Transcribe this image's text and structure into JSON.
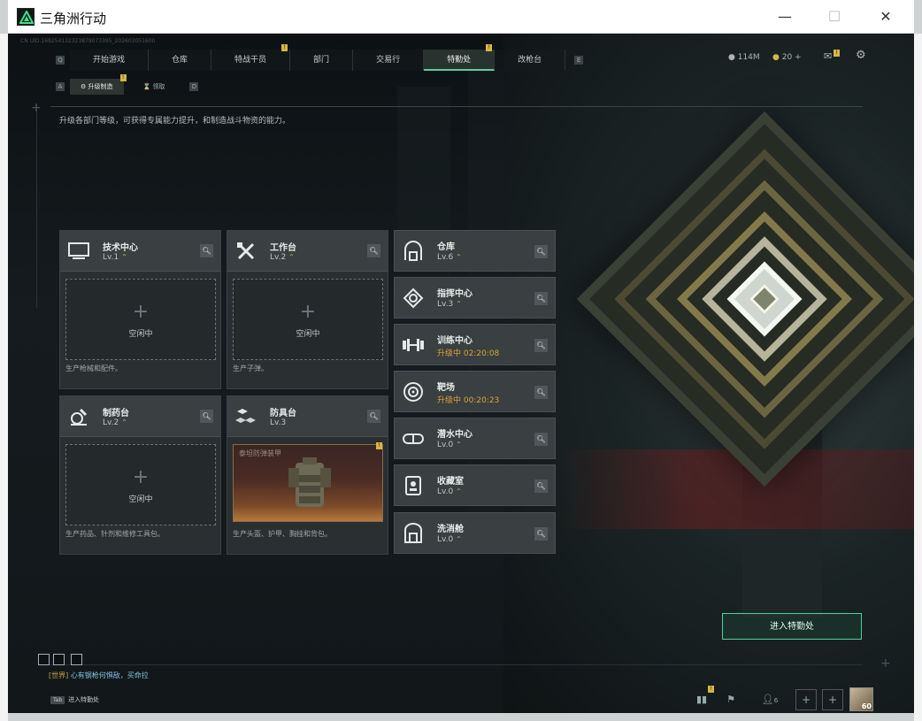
{
  "window": {
    "title": "三角洲行动",
    "minimize": "—",
    "maximize": "☐",
    "close": "✕"
  },
  "top_info": "CN UID:169254132323879073395_202603051600",
  "tabs": [
    {
      "label": "开始游戏",
      "badge": ""
    },
    {
      "label": "仓库",
      "badge": ""
    },
    {
      "label": "特战干员",
      "badge": "!"
    },
    {
      "label": "部门",
      "badge": ""
    },
    {
      "label": "交易行",
      "badge": ""
    },
    {
      "label": "特勤处",
      "badge": "!"
    },
    {
      "label": "改枪台",
      "badge": ""
    }
  ],
  "tab_prev_key": "Q",
  "tab_next_key": "E",
  "currency": {
    "coins": "114M",
    "tickets": "20",
    "add": "+"
  },
  "subtabs": [
    {
      "label": "升级制造",
      "badge": "!"
    },
    {
      "label": "领取",
      "badge": ""
    }
  ],
  "subtab_prev_key": "A",
  "subtab_next_key": "D",
  "description": "升级各部门等级，可获得专属能力提升，和制造战斗物资的能力。",
  "production": [
    {
      "name": "技术中心",
      "level": "Lv.1",
      "slot": "空闲中",
      "footer": "生产枪械和配件。"
    },
    {
      "name": "工作台",
      "level": "Lv.2",
      "slot": "空闲中",
      "footer": "生产子弹。"
    },
    {
      "name": "制药台",
      "level": "Lv.2",
      "slot": "空闲中",
      "footer": "生产药品、针剂和维修工具包。"
    },
    {
      "name": "防具台",
      "level": "Lv.3",
      "slot_item": "泰坦防弹装甲",
      "footer": "生产头盔、护甲、胸挂和背包。",
      "badge": "!"
    }
  ],
  "facilities": [
    {
      "name": "仓库",
      "status": "Lv.6"
    },
    {
      "name": "指挥中心",
      "status": "Lv.3"
    },
    {
      "name": "训练中心",
      "status": "升级中 02:20:08"
    },
    {
      "name": "靶场",
      "status": "升级中 00:20:23"
    },
    {
      "name": "潜水中心",
      "status": "Lv.0"
    },
    {
      "name": "收藏室",
      "status": "Lv.0"
    },
    {
      "name": "洗消舱",
      "status": "Lv.0"
    }
  ],
  "enter_button": "进入特勤处",
  "chat": {
    "channel": "[世界]",
    "message": "心有钢枪何惧敌，买命拉"
  },
  "tab_hint": {
    "key": "Tab",
    "label": "进入特勤处"
  },
  "bottom": {
    "friends_count": "6",
    "level": "60",
    "notif_badge": "!"
  },
  "colors": {
    "accent": "#5ad19c",
    "upgrade": "#d9a53a",
    "badge": "#d7b541"
  }
}
